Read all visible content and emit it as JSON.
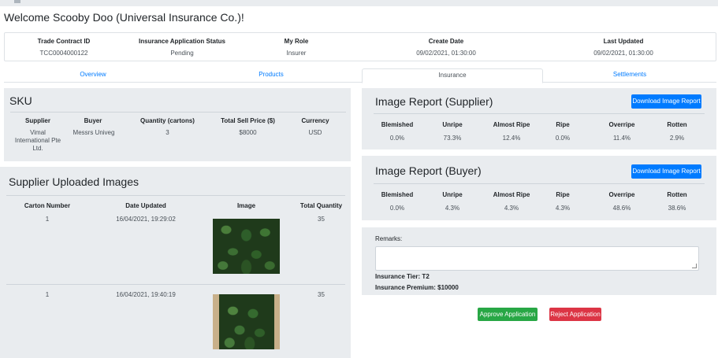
{
  "welcome": "Welcome Scooby Doo (Universal Insurance Co.)!",
  "summary": {
    "trade_contract_id_label": "Trade Contract ID",
    "trade_contract_id": "TCC0004000122",
    "status_label": "Insurance Application Status",
    "status": "Pending",
    "role_label": "My Role",
    "role": "Insurer",
    "create_date_label": "Create Date",
    "create_date": "09/02/2021, 01:30:00",
    "last_updated_label": "Last Updated",
    "last_updated": "09/02/2021, 01:30:00"
  },
  "tabs": [
    "Overview",
    "Products",
    "Insurance",
    "Settlements"
  ],
  "sku": {
    "title": "SKU",
    "headers": [
      "Supplier",
      "Buyer",
      "Quantity (cartons)",
      "Total Sell Price ($)",
      "Currency"
    ],
    "supplier_lines": [
      "Vimal",
      "International Pte",
      "Ltd."
    ],
    "buyer": "Messrs Univeg",
    "quantity": "3",
    "price": "$8000",
    "currency": "USD"
  },
  "uploaded": {
    "title": "Supplier Uploaded Images",
    "headers": [
      "Carton Number",
      "Date Updated",
      "Image",
      "Total Quantity"
    ],
    "rows": [
      {
        "carton": "1",
        "date": "16/04/2021, 19:29:02",
        "qty": "35"
      },
      {
        "carton": "1",
        "date": "16/04/2021, 19:40:19",
        "qty": "35"
      }
    ]
  },
  "report_supplier": {
    "title": "Image Report (Supplier)",
    "button": "Download Image Report",
    "headers": [
      "Blemished",
      "Unripe",
      "Almost Ripe",
      "Ripe",
      "Overripe",
      "Rotten"
    ],
    "values": [
      "0.0%",
      "73.3%",
      "12.4%",
      "0.0%",
      "11.4%",
      "2.9%"
    ]
  },
  "report_buyer": {
    "title": "Image Report (Buyer)",
    "button": "Download Image Report",
    "headers": [
      "Blemished",
      "Unripe",
      "Almost Ripe",
      "Ripe",
      "Overripe",
      "Rotten"
    ],
    "values": [
      "0.0%",
      "4.3%",
      "4.3%",
      "4.3%",
      "48.6%",
      "38.6%"
    ]
  },
  "remarks": {
    "label": "Remarks:",
    "tier": "Insurance Tier: T2",
    "premium": "Insurance Premium: $10000"
  },
  "actions": {
    "approve": "Approve Application",
    "reject": "Reject Application"
  },
  "colors": {
    "primary": "#007bff",
    "success": "#28a745",
    "danger": "#dc3545",
    "panel": "#e9ecef"
  }
}
